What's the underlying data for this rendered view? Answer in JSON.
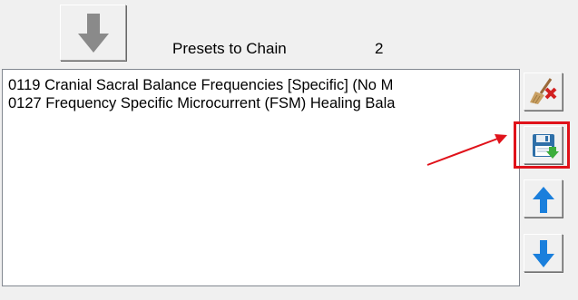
{
  "toolbar": {
    "add_button_icon": "down-arrow-icon",
    "presets_label": "Presets to Chain",
    "presets_count": "2"
  },
  "preset_list": {
    "items": [
      "0119 Cranial Sacral Balance Frequencies [Specific] (No M",
      "0127 Frequency Specific Microcurrent (FSM) Healing Bala"
    ]
  },
  "side_buttons": {
    "clear_icon": "broom-delete-icon",
    "save_icon": "floppy-save-icon",
    "move_up_icon": "up-arrow-icon",
    "move_down_icon": "down-arrow-icon"
  },
  "colors": {
    "highlight": "#e0121a",
    "arrow_blue": "#1a7fdc",
    "disabled_gray": "#8a8a8a"
  }
}
